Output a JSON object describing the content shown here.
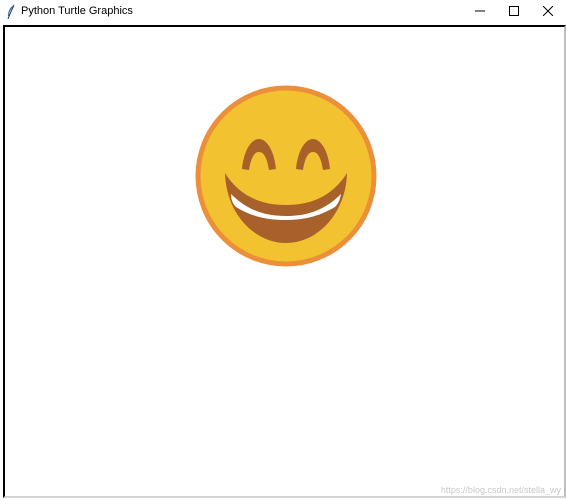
{
  "window": {
    "title": "Python Turtle Graphics",
    "controls": {
      "minimize_glyph": "—",
      "maximize_glyph": "☐",
      "close_glyph": "✕"
    }
  },
  "canvas": {
    "drawing": "grinning-face-emoji",
    "colors": {
      "face_fill": "#f2c230",
      "face_outline": "#ec8f3a",
      "features": "#a8612a",
      "teeth": "#ffffff",
      "background": "#ffffff"
    }
  },
  "watermark": {
    "text": "https://blog.csdn.net/stella_wy"
  }
}
